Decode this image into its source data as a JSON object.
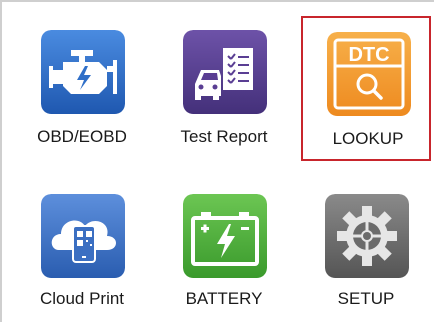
{
  "menu": {
    "items": [
      {
        "id": "obd",
        "label": "OBD/EOBD",
        "icon": "engine-icon",
        "color": "#2f6fc8"
      },
      {
        "id": "report",
        "label": "Test Report",
        "icon": "car-report-icon",
        "color": "#5a3e93"
      },
      {
        "id": "lookup",
        "label": "LOOKUP",
        "icon": "dtc-search-icon",
        "color": "#f29a2e",
        "badge": "DTC",
        "selected": true
      },
      {
        "id": "cloud",
        "label": "Cloud Print",
        "icon": "cloud-print-icon",
        "color": "#3b6fc2"
      },
      {
        "id": "battery",
        "label": "BATTERY",
        "icon": "battery-icon",
        "color": "#4fae3c"
      },
      {
        "id": "setup",
        "label": "SETUP",
        "icon": "gear-icon",
        "color": "#707070"
      }
    ],
    "selection_color": "#c8252c"
  }
}
